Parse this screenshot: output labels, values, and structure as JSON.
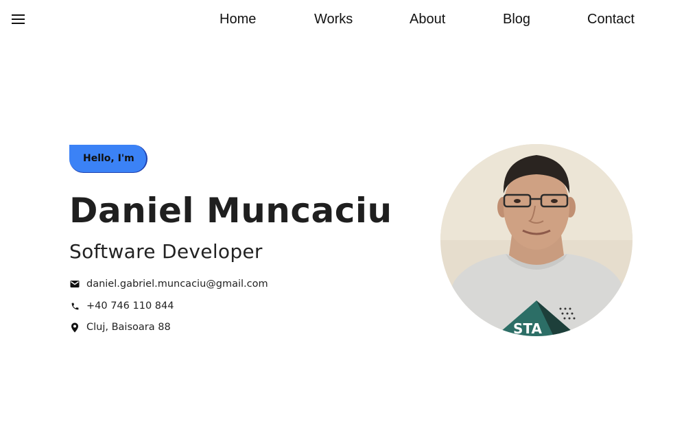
{
  "nav": {
    "menu_icon": "menu-icon",
    "links": [
      "Home",
      "Works",
      "About",
      "Blog",
      "Contact"
    ]
  },
  "hero": {
    "greeting": "Hello, I'm",
    "name": "Daniel Muncaciu",
    "role": "Software Developer",
    "accent_color": "#3b82f6"
  },
  "contact": {
    "email": {
      "icon": "mail-icon",
      "text": "daniel.gabriel.muncaciu@gmail.com"
    },
    "phone": {
      "icon": "phone-icon",
      "text": "+40 746 110 844"
    },
    "location": {
      "icon": "location-pin-icon",
      "text": "Cluj, Baisoara 88"
    }
  },
  "photo": {
    "alt": "Daniel Muncaciu",
    "shirt_text": "STA"
  }
}
